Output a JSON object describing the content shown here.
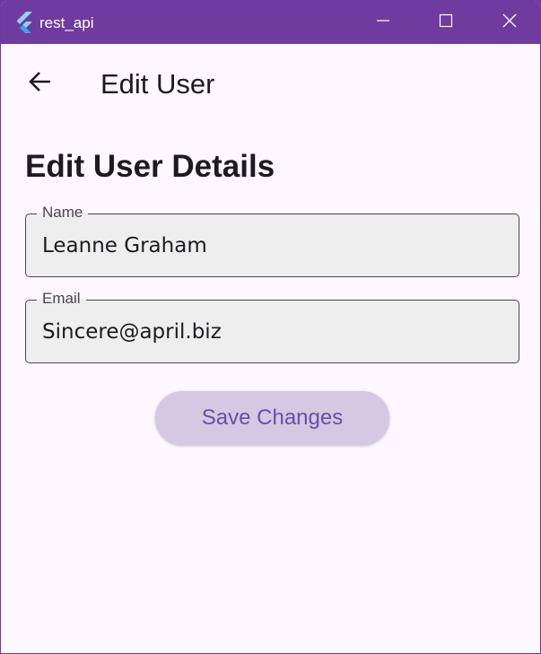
{
  "window": {
    "title": "rest_api",
    "app_icon": "flutter-logo-icon",
    "controls": {
      "minimize": "minimize-icon",
      "maximize": "maximize-icon",
      "close": "close-icon"
    }
  },
  "appbar": {
    "back_icon": "arrow-left-icon",
    "title": "Edit User"
  },
  "main": {
    "heading": "Edit User Details",
    "fields": {
      "name": {
        "label": "Name",
        "value": "Leanne Graham"
      },
      "email": {
        "label": "Email",
        "value": "Sincere@april.biz"
      }
    },
    "save_label": "Save Changes"
  },
  "colors": {
    "titlebar": "#6f3b9e",
    "background": "#fdf7ff",
    "button_bg": "#d4c8e3",
    "button_text": "#6750a4"
  }
}
